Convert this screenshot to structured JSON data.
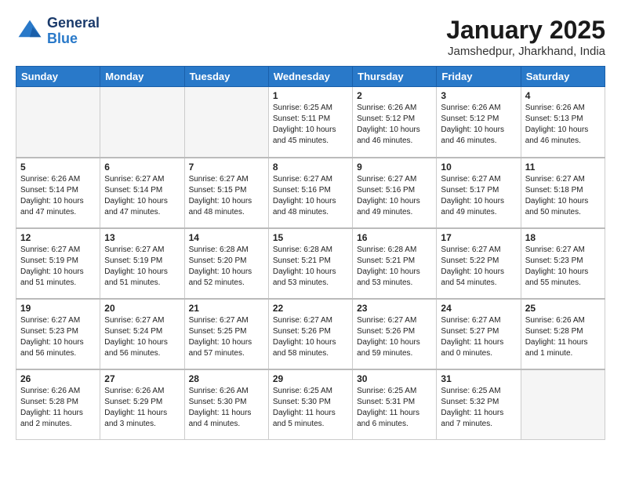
{
  "logo": {
    "line1": "General",
    "line2": "Blue"
  },
  "title": "January 2025",
  "location": "Jamshedpur, Jharkhand, India",
  "weekdays": [
    "Sunday",
    "Monday",
    "Tuesday",
    "Wednesday",
    "Thursday",
    "Friday",
    "Saturday"
  ],
  "weeks": [
    [
      {
        "day": "",
        "sunrise": "",
        "sunset": "",
        "daylight": ""
      },
      {
        "day": "",
        "sunrise": "",
        "sunset": "",
        "daylight": ""
      },
      {
        "day": "",
        "sunrise": "",
        "sunset": "",
        "daylight": ""
      },
      {
        "day": "1",
        "sunrise": "Sunrise: 6:25 AM",
        "sunset": "Sunset: 5:11 PM",
        "daylight": "Daylight: 10 hours and 45 minutes."
      },
      {
        "day": "2",
        "sunrise": "Sunrise: 6:26 AM",
        "sunset": "Sunset: 5:12 PM",
        "daylight": "Daylight: 10 hours and 46 minutes."
      },
      {
        "day": "3",
        "sunrise": "Sunrise: 6:26 AM",
        "sunset": "Sunset: 5:12 PM",
        "daylight": "Daylight: 10 hours and 46 minutes."
      },
      {
        "day": "4",
        "sunrise": "Sunrise: 6:26 AM",
        "sunset": "Sunset: 5:13 PM",
        "daylight": "Daylight: 10 hours and 46 minutes."
      }
    ],
    [
      {
        "day": "5",
        "sunrise": "Sunrise: 6:26 AM",
        "sunset": "Sunset: 5:14 PM",
        "daylight": "Daylight: 10 hours and 47 minutes."
      },
      {
        "day": "6",
        "sunrise": "Sunrise: 6:27 AM",
        "sunset": "Sunset: 5:14 PM",
        "daylight": "Daylight: 10 hours and 47 minutes."
      },
      {
        "day": "7",
        "sunrise": "Sunrise: 6:27 AM",
        "sunset": "Sunset: 5:15 PM",
        "daylight": "Daylight: 10 hours and 48 minutes."
      },
      {
        "day": "8",
        "sunrise": "Sunrise: 6:27 AM",
        "sunset": "Sunset: 5:16 PM",
        "daylight": "Daylight: 10 hours and 48 minutes."
      },
      {
        "day": "9",
        "sunrise": "Sunrise: 6:27 AM",
        "sunset": "Sunset: 5:16 PM",
        "daylight": "Daylight: 10 hours and 49 minutes."
      },
      {
        "day": "10",
        "sunrise": "Sunrise: 6:27 AM",
        "sunset": "Sunset: 5:17 PM",
        "daylight": "Daylight: 10 hours and 49 minutes."
      },
      {
        "day": "11",
        "sunrise": "Sunrise: 6:27 AM",
        "sunset": "Sunset: 5:18 PM",
        "daylight": "Daylight: 10 hours and 50 minutes."
      }
    ],
    [
      {
        "day": "12",
        "sunrise": "Sunrise: 6:27 AM",
        "sunset": "Sunset: 5:19 PM",
        "daylight": "Daylight: 10 hours and 51 minutes."
      },
      {
        "day": "13",
        "sunrise": "Sunrise: 6:27 AM",
        "sunset": "Sunset: 5:19 PM",
        "daylight": "Daylight: 10 hours and 51 minutes."
      },
      {
        "day": "14",
        "sunrise": "Sunrise: 6:28 AM",
        "sunset": "Sunset: 5:20 PM",
        "daylight": "Daylight: 10 hours and 52 minutes."
      },
      {
        "day": "15",
        "sunrise": "Sunrise: 6:28 AM",
        "sunset": "Sunset: 5:21 PM",
        "daylight": "Daylight: 10 hours and 53 minutes."
      },
      {
        "day": "16",
        "sunrise": "Sunrise: 6:28 AM",
        "sunset": "Sunset: 5:21 PM",
        "daylight": "Daylight: 10 hours and 53 minutes."
      },
      {
        "day": "17",
        "sunrise": "Sunrise: 6:27 AM",
        "sunset": "Sunset: 5:22 PM",
        "daylight": "Daylight: 10 hours and 54 minutes."
      },
      {
        "day": "18",
        "sunrise": "Sunrise: 6:27 AM",
        "sunset": "Sunset: 5:23 PM",
        "daylight": "Daylight: 10 hours and 55 minutes."
      }
    ],
    [
      {
        "day": "19",
        "sunrise": "Sunrise: 6:27 AM",
        "sunset": "Sunset: 5:23 PM",
        "daylight": "Daylight: 10 hours and 56 minutes."
      },
      {
        "day": "20",
        "sunrise": "Sunrise: 6:27 AM",
        "sunset": "Sunset: 5:24 PM",
        "daylight": "Daylight: 10 hours and 56 minutes."
      },
      {
        "day": "21",
        "sunrise": "Sunrise: 6:27 AM",
        "sunset": "Sunset: 5:25 PM",
        "daylight": "Daylight: 10 hours and 57 minutes."
      },
      {
        "day": "22",
        "sunrise": "Sunrise: 6:27 AM",
        "sunset": "Sunset: 5:26 PM",
        "daylight": "Daylight: 10 hours and 58 minutes."
      },
      {
        "day": "23",
        "sunrise": "Sunrise: 6:27 AM",
        "sunset": "Sunset: 5:26 PM",
        "daylight": "Daylight: 10 hours and 59 minutes."
      },
      {
        "day": "24",
        "sunrise": "Sunrise: 6:27 AM",
        "sunset": "Sunset: 5:27 PM",
        "daylight": "Daylight: 11 hours and 0 minutes."
      },
      {
        "day": "25",
        "sunrise": "Sunrise: 6:26 AM",
        "sunset": "Sunset: 5:28 PM",
        "daylight": "Daylight: 11 hours and 1 minute."
      }
    ],
    [
      {
        "day": "26",
        "sunrise": "Sunrise: 6:26 AM",
        "sunset": "Sunset: 5:28 PM",
        "daylight": "Daylight: 11 hours and 2 minutes."
      },
      {
        "day": "27",
        "sunrise": "Sunrise: 6:26 AM",
        "sunset": "Sunset: 5:29 PM",
        "daylight": "Daylight: 11 hours and 3 minutes."
      },
      {
        "day": "28",
        "sunrise": "Sunrise: 6:26 AM",
        "sunset": "Sunset: 5:30 PM",
        "daylight": "Daylight: 11 hours and 4 minutes."
      },
      {
        "day": "29",
        "sunrise": "Sunrise: 6:25 AM",
        "sunset": "Sunset: 5:30 PM",
        "daylight": "Daylight: 11 hours and 5 minutes."
      },
      {
        "day": "30",
        "sunrise": "Sunrise: 6:25 AM",
        "sunset": "Sunset: 5:31 PM",
        "daylight": "Daylight: 11 hours and 6 minutes."
      },
      {
        "day": "31",
        "sunrise": "Sunrise: 6:25 AM",
        "sunset": "Sunset: 5:32 PM",
        "daylight": "Daylight: 11 hours and 7 minutes."
      },
      {
        "day": "",
        "sunrise": "",
        "sunset": "",
        "daylight": ""
      }
    ]
  ]
}
